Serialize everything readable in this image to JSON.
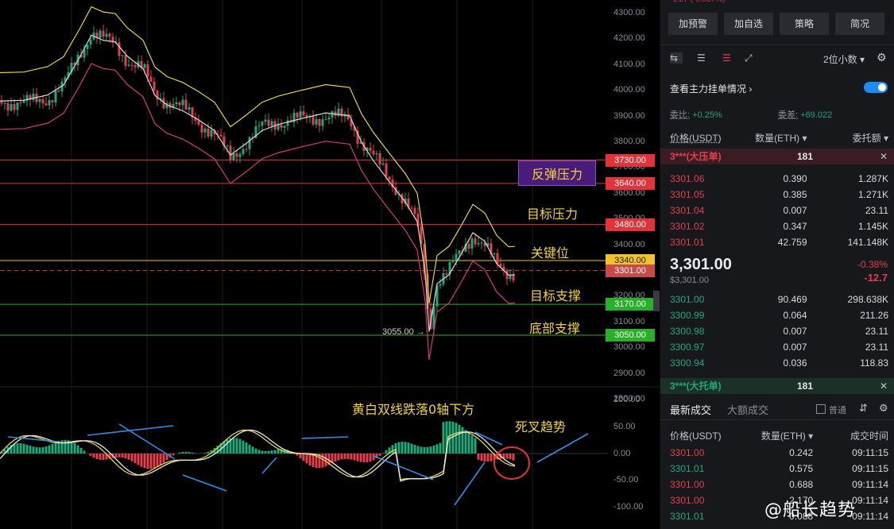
{
  "chart": {
    "price_levels": [
      {
        "value": "3730.00",
        "color": "#e0333a"
      },
      {
        "value": "3640.00",
        "color": "#e0333a"
      },
      {
        "value": "3480.00",
        "color": "#e0333a"
      },
      {
        "value": "3340.00",
        "color": "#f2c12e"
      },
      {
        "value": "3301.00",
        "color": "#c94a4a"
      },
      {
        "value": "3170.00",
        "color": "#28b028"
      },
      {
        "value": "3050.00",
        "color": "#28b028"
      }
    ],
    "y_axis": [
      "4300.00",
      "4200.00",
      "4100.00",
      "4000.00",
      "3900.00",
      "3800.00",
      "3700.00",
      "3600.00",
      "3500.00",
      "3400.00",
      "3300.00",
      "3200.00",
      "3100.00",
      "3000.00",
      "2900.00",
      "2800.00"
    ],
    "macd_axis": [
      "100.00",
      "50.00",
      "0.00",
      "-50.00",
      "-100.00"
    ],
    "low_marker": "3055.00 →",
    "annotations": {
      "rebound_pressure": "反弹压力",
      "target_pressure": "目标压力",
      "key_level": "关键位",
      "target_support": "目标支撑",
      "bottom_support": "底部支撑",
      "macd_note": "黄白双线跌落0轴下方",
      "death_cross": "死叉趋势"
    }
  },
  "sidebar": {
    "buttons": [
      "加预警",
      "加自选",
      "策略",
      "简况"
    ],
    "decimal_select": "2位小数",
    "main_orders_link": "查看主力挂单情况",
    "ratio_label": "委比:",
    "ratio_value": "+0.25%",
    "diff_label": "委差:",
    "diff_value": "+69.022",
    "headers": {
      "price": "价格(USDT)",
      "qty": "数量(ETH)",
      "total": "委托额"
    },
    "big_ask": {
      "label": "3***(大压单)",
      "qty": "181"
    },
    "asks": [
      {
        "price": "3301.06",
        "qty": "0.390",
        "total": "1.287K"
      },
      {
        "price": "3301.05",
        "qty": "0.385",
        "total": "1.271K"
      },
      {
        "price": "3301.04",
        "qty": "0.007",
        "total": "23.11"
      },
      {
        "price": "3301.02",
        "qty": "0.347",
        "total": "1.145K"
      },
      {
        "price": "3301.01",
        "qty": "42.759",
        "total": "141.148K"
      }
    ],
    "last_price": "3,301.00",
    "last_price_usd": "$3,301.00",
    "change_pct": "-0.38%",
    "change_abs": "-12.7",
    "bids": [
      {
        "price": "3301.00",
        "qty": "90.469",
        "total": "298.638K"
      },
      {
        "price": "3300.99",
        "qty": "0.064",
        "total": "211.26"
      },
      {
        "price": "3300.98",
        "qty": "0.007",
        "total": "23.11"
      },
      {
        "price": "3300.97",
        "qty": "0.007",
        "total": "23.11"
      },
      {
        "price": "3300.94",
        "qty": "0.036",
        "total": "118.83"
      }
    ],
    "big_bid": {
      "label": "3***(大托单)",
      "qty": "181"
    },
    "trade_tabs": {
      "latest": "最新成交",
      "large": "大额成交",
      "normal": "普通"
    },
    "trade_headers": {
      "price": "价格(USDT)",
      "qty": "数量(ETH)",
      "time": "成交时间"
    },
    "trades": [
      {
        "price": "3301.00",
        "qty": "0.242",
        "time": "09:11:15",
        "side": "sell"
      },
      {
        "price": "3301.01",
        "qty": "0.575",
        "time": "09:11:15",
        "side": "buy"
      },
      {
        "price": "3301.00",
        "qty": "0.688",
        "time": "09:11:14",
        "side": "sell"
      },
      {
        "price": "3301.00",
        "qty": "2.170",
        "time": "09:11:14",
        "side": "sell"
      },
      {
        "price": "3301.01",
        "qty": "0.088",
        "time": "09:11:14",
        "side": "buy"
      }
    ],
    "watermark": "@船长趋势"
  },
  "colors": {
    "up": "#1fa97a",
    "down": "#e0414c",
    "accent": "#1c8cf5"
  }
}
